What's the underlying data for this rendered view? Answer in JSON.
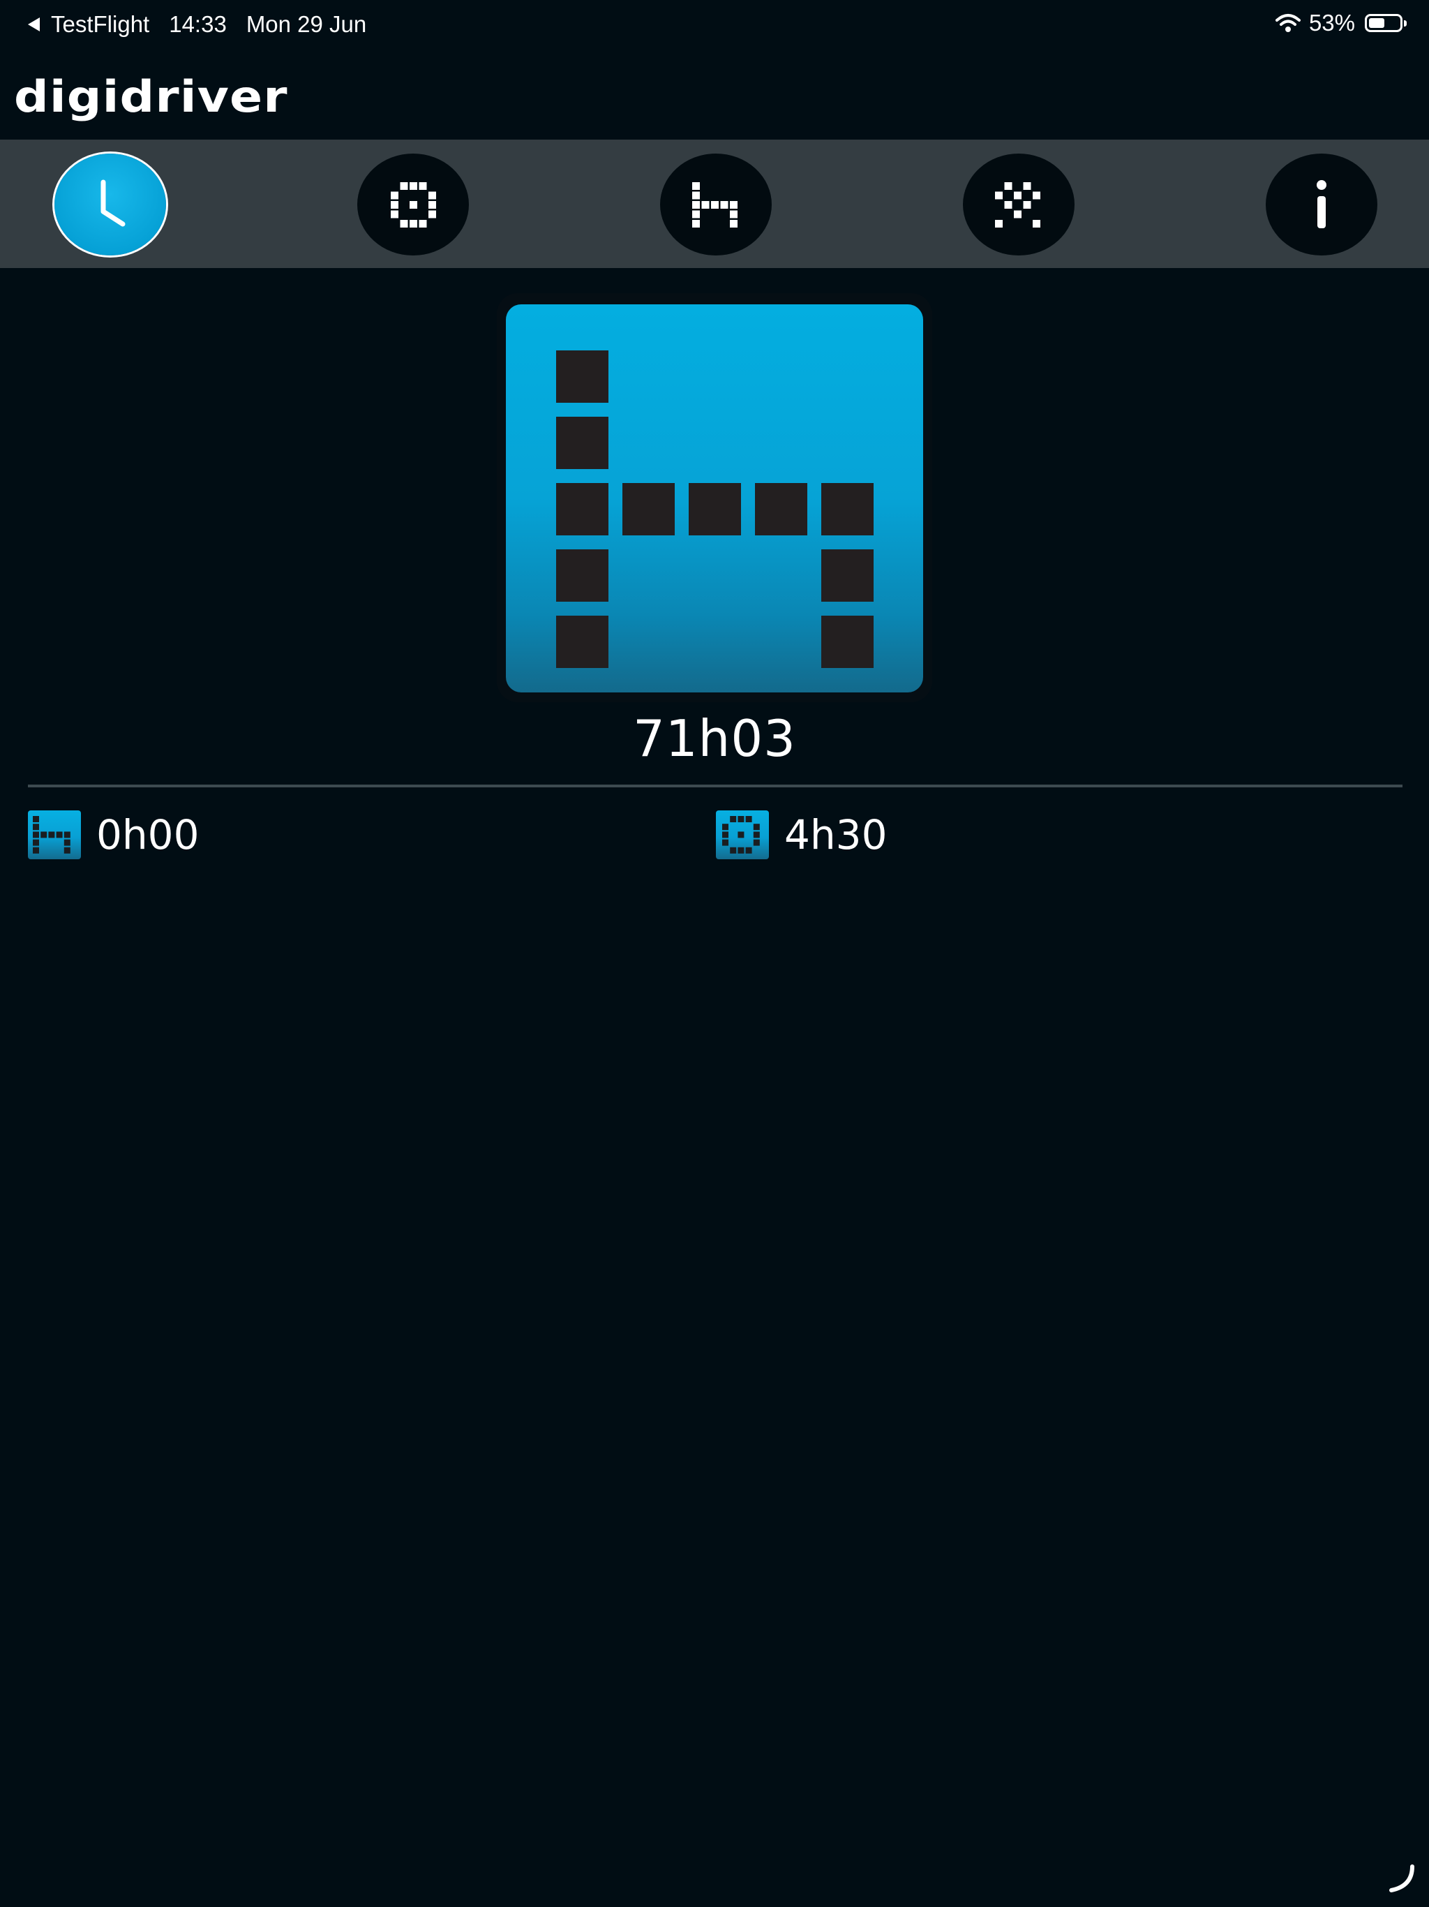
{
  "status_bar": {
    "back_app": "TestFlight",
    "time": "14:33",
    "date": "Mon 29 Jun",
    "battery_percent": "53%",
    "battery_level": 0.53
  },
  "header": {
    "logo": "digidriver"
  },
  "tabs": [
    {
      "icon": "clock-icon",
      "active": true
    },
    {
      "icon": "pixel-square-icon",
      "active": false
    },
    {
      "icon": "pixel-bed-icon",
      "active": false
    },
    {
      "icon": "pixel-tools-icon",
      "active": false
    },
    {
      "icon": "info-icon",
      "active": false
    }
  ],
  "main": {
    "icon": "pixel-bed-icon",
    "value": "71h03"
  },
  "sub_items": [
    {
      "icon": "pixel-bed-icon",
      "value": "0h00"
    },
    {
      "icon": "pixel-square-icon",
      "value": "4h30"
    }
  ],
  "colors": {
    "accent": "#06a3d6",
    "background": "#010d14",
    "tab_bar": "#343d42"
  }
}
